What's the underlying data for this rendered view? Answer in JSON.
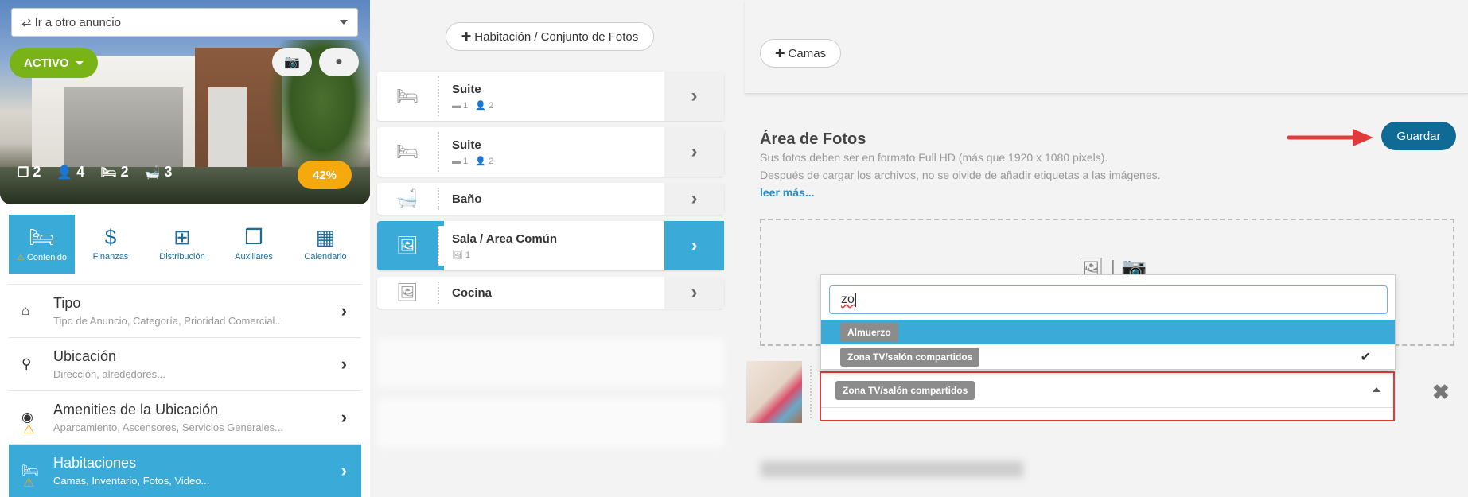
{
  "header": {
    "listing_select": "Ir a otro anuncio",
    "status": "ACTIVO",
    "stats": {
      "rooms": "2",
      "guests": "4",
      "beds": "2",
      "baths": "3"
    },
    "completion": "42%"
  },
  "tabs": [
    {
      "label": "Contenido",
      "icon": "bed-icon"
    },
    {
      "label": "Finanzas",
      "icon": "dollar-icon"
    },
    {
      "label": "Distribución",
      "icon": "sitemap-icon"
    },
    {
      "label": "Auxiliares",
      "icon": "cubes-icon"
    },
    {
      "label": "Calendario",
      "icon": "calendar-icon"
    }
  ],
  "menu": [
    {
      "title": "Tipo",
      "sub": "Tipo de Anuncio, Categoría, Prioridad Comercial...",
      "icon": "home-icon"
    },
    {
      "title": "Ubicación",
      "sub": "Dirección, alrededores...",
      "icon": "map-pin-icon"
    },
    {
      "title": "Amenities de la Ubicación",
      "sub": "Aparcamiento, Ascensores, Servicios Generales...",
      "icon": "target-icon"
    },
    {
      "title": "Habitaciones",
      "sub": "Camas, Inventario, Fotos, Video...",
      "icon": "bed-icon"
    }
  ],
  "rooms": {
    "add_label": "Habitación / Conjunto de Fotos",
    "items": [
      {
        "title": "Suite",
        "beds": "1",
        "guests": "2"
      },
      {
        "title": "Suite",
        "beds": "1",
        "guests": "2"
      },
      {
        "title": "Baño"
      },
      {
        "title": "Sala / Area Común",
        "photos": "1"
      },
      {
        "title": "Cocina"
      }
    ]
  },
  "beds_button": "Camas",
  "photos": {
    "title": "Área de Fotos",
    "line1": "Sus fotos deben ser en formato Full HD (más que 1920 x 1080 pixels).",
    "line2": "Después de cargar los archivos, no se olvide de añadir etiquetas a las imágenes.",
    "more": "leer más...",
    "save": "Guardar",
    "search_value": "zo",
    "options": [
      "Almuerzo",
      "Zona TV/salón compartidos"
    ],
    "selected_tag": "Zona TV/salón compartidos"
  },
  "colors": {
    "accent": "#3aabd9",
    "save": "#0f6b96",
    "active": "#7ab317",
    "warning": "#f5a90c",
    "highlight": "#e23a3a"
  }
}
